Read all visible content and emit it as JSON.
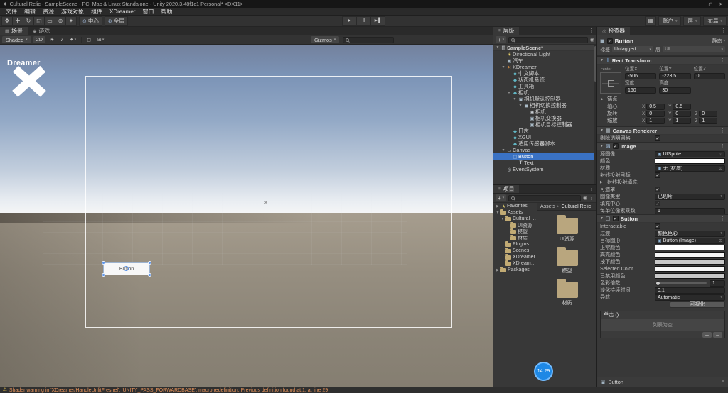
{
  "window": {
    "title": "Cultural Relic - SampleScene - PC, Mac & Linux Standalone - Unity 2020.3.48f1c1 Personal* <DX11>",
    "controls": {
      "minimize": "—",
      "maximize": "▢",
      "close": "✕"
    }
  },
  "menu": {
    "items": [
      "文件",
      "编辑",
      "资源",
      "游戏对象",
      "组件",
      "XDreamer",
      "窗口",
      "帮助"
    ]
  },
  "toolbar": {
    "tools": [
      "hand",
      "move",
      "rotate",
      "scale",
      "rect",
      "transform",
      "custom"
    ],
    "pivot_label": "中心",
    "space_label": "全局",
    "account_label": "账户",
    "layers_label": "层",
    "layout_label": "布局"
  },
  "scene": {
    "tabs": [
      {
        "label": "场景"
      },
      {
        "label": "游戏"
      }
    ],
    "toolbar": {
      "shading": "Shaded",
      "mode_2d": "2D",
      "gizmos": "Gizmos",
      "search_placeholder": ""
    },
    "logo_text": "Dreamer",
    "canvas_button_label": "Button"
  },
  "hierarchy": {
    "tab_label": "层级",
    "create_label": "+",
    "items": [
      {
        "label": "SampleScene*",
        "depth": 0,
        "arrow": "▼",
        "icon": "scene",
        "header": true
      },
      {
        "label": "Directional Light",
        "depth": 1,
        "icon": "light"
      },
      {
        "label": "汽车",
        "depth": 1,
        "icon": "cube"
      },
      {
        "label": "XDreamer",
        "depth": 1,
        "arrow": "▼",
        "icon": "xdreamer"
      },
      {
        "label": "中文脚本",
        "depth": 2,
        "icon": "module"
      },
      {
        "label": "状态机系统",
        "depth": 2,
        "icon": "module"
      },
      {
        "label": "工具箱",
        "depth": 2,
        "icon": "module"
      },
      {
        "label": "相机",
        "depth": 2,
        "arrow": "▼",
        "icon": "module"
      },
      {
        "label": "相机默认控制器",
        "depth": 3,
        "arrow": "▼",
        "icon": "cube"
      },
      {
        "label": "相机切换控制器",
        "depth": 4,
        "arrow": "▼",
        "icon": "cube"
      },
      {
        "label": "相机",
        "depth": 5,
        "icon": "camera"
      },
      {
        "label": "相机变换器",
        "depth": 5,
        "icon": "cube"
      },
      {
        "label": "相机目标控制器",
        "depth": 5,
        "icon": "cube"
      },
      {
        "label": "日志",
        "depth": 2,
        "icon": "module"
      },
      {
        "label": "XGUI",
        "depth": 2,
        "icon": "module"
      },
      {
        "label": "适用传感器脚本",
        "depth": 2,
        "icon": "module"
      },
      {
        "label": "Canvas",
        "depth": 1,
        "arrow": "▼",
        "icon": "canvas"
      },
      {
        "label": "Button",
        "depth": 2,
        "icon": "button",
        "selected": true
      },
      {
        "label": "Text",
        "depth": 3,
        "icon": "text"
      },
      {
        "label": "EventSystem",
        "depth": 1,
        "icon": "event"
      }
    ]
  },
  "project": {
    "tab_label": "项目",
    "create_label": "+",
    "tree": [
      {
        "label": "Favorites",
        "depth": 0,
        "arrow": "▶",
        "icon": "star"
      },
      {
        "label": "Assets",
        "depth": 0,
        "arrow": "▼",
        "icon": "folder"
      },
      {
        "label": "Cultural Re...",
        "depth": 1,
        "arrow": "▼",
        "icon": "folder"
      },
      {
        "label": "UI资源",
        "depth": 2,
        "icon": "folder"
      },
      {
        "label": "模型",
        "depth": 2,
        "icon": "folder"
      },
      {
        "label": "材质",
        "depth": 2,
        "icon": "folder"
      },
      {
        "label": "Plugins",
        "depth": 1,
        "icon": "folder"
      },
      {
        "label": "Scenes",
        "depth": 1,
        "icon": "folder"
      },
      {
        "label": "XDreamer",
        "depth": 1,
        "icon": "folder"
      },
      {
        "label": "XDreamer...",
        "depth": 1,
        "icon": "folder"
      },
      {
        "label": "Packages",
        "depth": 0,
        "arrow": "▶",
        "icon": "folder"
      }
    ],
    "breadcrumb": [
      "Assets",
      "Cultural Relic"
    ],
    "folders": [
      "UI资源",
      "模型",
      "材质"
    ]
  },
  "inspector": {
    "tab_label": "检查器",
    "header": {
      "name": "Button",
      "static_label": "静态",
      "tag_label": "标签",
      "tag_value": "Untagged",
      "layer_label": "层",
      "layer_value": "UI"
    },
    "rect_transform": {
      "title": "Rect Transform",
      "anchor_preset_label": "center",
      "grid": {
        "labels1": [
          "位置X",
          "位置Y",
          "位置Z"
        ],
        "values1": [
          "-506",
          "-223.5",
          "0"
        ],
        "labels2": [
          "宽度",
          "高度",
          ""
        ],
        "values2": [
          "160",
          "30",
          ""
        ]
      },
      "rows": [
        {
          "type": "foldout",
          "label": "锚点"
        },
        {
          "type": "axes",
          "label": "轴心",
          "axes": [
            {
              "k": "X",
              "v": "0.5"
            },
            {
              "k": "Y",
              "v": "0.5"
            }
          ]
        },
        {
          "type": "axes",
          "label": "旋转",
          "axes": [
            {
              "k": "X",
              "v": "0"
            },
            {
              "k": "Y",
              "v": "0"
            },
            {
              "k": "Z",
              "v": "0"
            }
          ]
        },
        {
          "type": "axes",
          "label": "缩放",
          "axes": [
            {
              "k": "X",
              "v": "1"
            },
            {
              "k": "Y",
              "v": "1"
            },
            {
              "k": "Z",
              "v": "1"
            }
          ]
        }
      ]
    },
    "canvas_renderer": {
      "title": "Canvas Renderer",
      "rows": [
        {
          "type": "check",
          "label": "剔除透明网格",
          "value": true
        }
      ]
    },
    "image": {
      "title": "Image",
      "rows": [
        {
          "type": "object",
          "label": "源图像",
          "value": "UISprite"
        },
        {
          "type": "color",
          "label": "颜色",
          "value": "#FFFFFF"
        },
        {
          "type": "object",
          "label": "材质",
          "value": "无 (材质)"
        },
        {
          "type": "check",
          "label": "射线投射目标",
          "value": true
        },
        {
          "type": "foldout",
          "label": "射线投射填充"
        },
        {
          "type": "check",
          "label": "可遮罩",
          "value": true
        },
        {
          "type": "dropdown",
          "label": "图像类型",
          "value": "已切片"
        },
        {
          "type": "check",
          "label": "填充中心",
          "value": true
        },
        {
          "type": "input",
          "label": "每单位像素乘数",
          "value": "1"
        }
      ]
    },
    "button": {
      "title": "Button",
      "rows": [
        {
          "type": "check",
          "label": "Interactable",
          "value": true
        },
        {
          "type": "dropdown",
          "label": "过渡",
          "value": "颜色色彩"
        },
        {
          "type": "object",
          "label": "目标图形",
          "value": "Button (Image)"
        },
        {
          "type": "color",
          "label": "正常颜色",
          "value": "#FFFFFF"
        },
        {
          "type": "color",
          "label": "高亮颜色",
          "value": "#F5F5F5"
        },
        {
          "type": "color",
          "label": "按下颜色",
          "value": "#C8C8C8"
        },
        {
          "type": "color",
          "label": "Selected Color",
          "value": "#F5F5F5"
        },
        {
          "type": "color",
          "label": "已禁用颜色",
          "value": "#C8C8C8"
        },
        {
          "type": "slider",
          "label": "色彩倍数",
          "value": "1"
        },
        {
          "type": "input",
          "label": "淡化持续时间",
          "value": "0.1"
        },
        {
          "type": "dropdown",
          "label": "导航",
          "value": "Automatic"
        },
        {
          "type": "action",
          "label": "",
          "value": "可视化"
        }
      ]
    },
    "on_click": {
      "title": "单击 ()",
      "empty_text": "列表为空",
      "add_label": "＋",
      "remove_label": "－"
    },
    "footer": {
      "label": "Button"
    }
  },
  "status_bar": {
    "warning": "Shader warning in 'XDreamer/HandleUnlitFresnel': 'UNITY_PASS_FORWARDBASE': macro redefinition. Previous definition found at:1, at line 29"
  },
  "overlay": {
    "timer": "14:29"
  },
  "colors": {
    "selection": "#3a72c4",
    "accent_blue": "#5b93e8",
    "warning_text": "#e2915a",
    "warning_icon": "#ffd24a",
    "record_badge": "#1e88e5"
  },
  "icon_glyphs": {
    "scene": "▤",
    "light": "☀",
    "cube": "▣",
    "xdreamer": "✕",
    "module": "◆",
    "camera": "◉",
    "canvas": "▭",
    "button": "▢",
    "text": "T",
    "event": "◎",
    "star": "★",
    "tools": {
      "hand": "✥",
      "move": "✚",
      "rotate": "↻",
      "scale": "◱",
      "rect": "▭",
      "transform": "⊕",
      "custom": "✦"
    },
    "play": {
      "play": "►",
      "pause": "Ⅱ",
      "step": "►▍"
    }
  }
}
